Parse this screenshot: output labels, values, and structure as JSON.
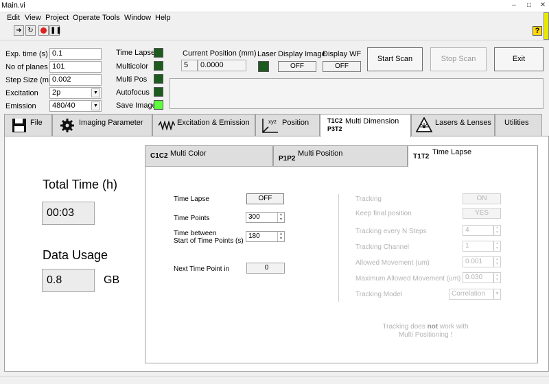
{
  "window": {
    "title": "Main.vi"
  },
  "menu": [
    "Edit",
    "View",
    "Project",
    "Operate",
    "Tools",
    "Window",
    "Help"
  ],
  "toolbar": {
    "help_label": "?"
  },
  "params": {
    "exp_time": {
      "label": "Exp. time (s)",
      "value": "0.1"
    },
    "no_planes": {
      "label": "No of planes",
      "value": "101"
    },
    "step_size": {
      "label": "Step Size (mm)",
      "value": "0.002"
    },
    "excitation": {
      "label": "Excitation",
      "value": "2p"
    },
    "emission": {
      "label": "Emission",
      "value": "480/40"
    }
  },
  "indicators": [
    {
      "label": "Time Lapse",
      "on": false
    },
    {
      "label": "Multicolor",
      "on": false
    },
    {
      "label": "Multi Pos",
      "on": false
    },
    {
      "label": "Autofocus",
      "on": false
    },
    {
      "label": "Save Image",
      "on": true
    }
  ],
  "position": {
    "label": "Current Position (mm)",
    "index": "5",
    "value": "0.0000"
  },
  "laser": {
    "label": "Laser"
  },
  "display_image": {
    "label": "Display Image",
    "state": "OFF"
  },
  "display_wf": {
    "label": "Display WF",
    "state": "OFF"
  },
  "buttons": {
    "start": "Start Scan",
    "stop": "Stop Scan",
    "exit": "Exit"
  },
  "tabs": [
    {
      "label": "File"
    },
    {
      "label": "Imaging Parameter"
    },
    {
      "label": "Excitation & Emission"
    },
    {
      "label": "Position"
    },
    {
      "label": "Multi Dimension",
      "active": true
    },
    {
      "label": "Lasers & Lenses"
    },
    {
      "label": "Utilities"
    }
  ],
  "tab_icons": {
    "position_icon_text": "xyz",
    "multidim_line1": "T1C2",
    "multidim_line2": "P3T2"
  },
  "summary": {
    "total_time_label": "Total Time (h)",
    "total_time_value": "00:03",
    "data_usage_label": "Data Usage",
    "data_usage_value": "0.8",
    "data_usage_unit": "GB"
  },
  "subtabs": [
    {
      "prefix": "C1C2",
      "label": "Multi Color"
    },
    {
      "prefix": "P1P2",
      "label": "Multi Position"
    },
    {
      "prefix": "T1T2",
      "label": "Time Lapse",
      "active": true
    }
  ],
  "timelapse": {
    "toggle_label": "Time Lapse",
    "toggle_state": "OFF",
    "time_points_label": "Time Points",
    "time_points_value": "300",
    "between_label_1": "Time between",
    "between_label_2": "Start of Time Points (s)",
    "between_value": "180",
    "next_label": "Next Time Point in",
    "next_value": "0"
  },
  "tracking": {
    "tracking_label": "Tracking",
    "tracking_state": "ON",
    "keep_label": "Keep final position",
    "keep_state": "YES",
    "every_label": "Tracking every N Steps",
    "every_value": "4",
    "channel_label": "Tracking Channel",
    "channel_value": "1",
    "allowed_label": "Allowed Movement (um)",
    "allowed_value": "0.001",
    "max_label": "Maximum Allowed Movement (um)",
    "max_value": "0.030",
    "model_label": "Tracking Model",
    "model_value": "Correlation",
    "note_pre": "Tracking does ",
    "note_bold": "not",
    "note_post": " work with",
    "note_line2": "Multi Positioning !"
  }
}
